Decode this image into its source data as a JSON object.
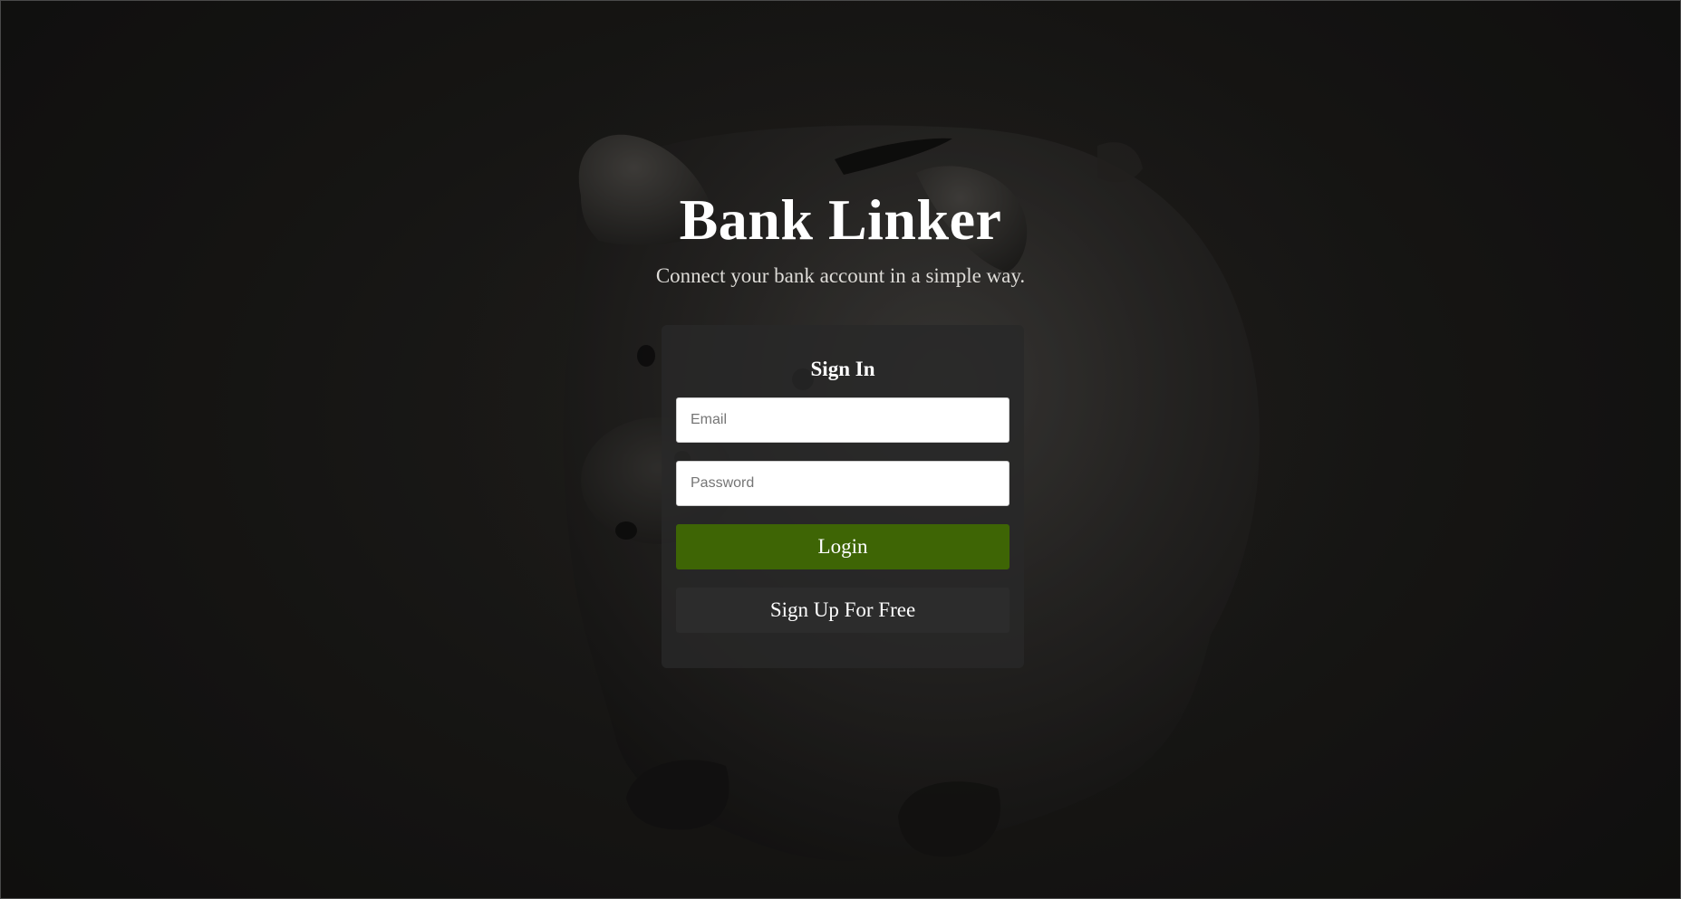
{
  "app": {
    "title": "Bank Linker",
    "tagline": "Connect your bank account in a simple way."
  },
  "signin": {
    "heading": "Sign In",
    "email_placeholder": "Email",
    "email_value": "",
    "password_placeholder": "Password",
    "password_value": "",
    "login_label": "Login",
    "signup_label": "Sign Up For Free"
  },
  "background": {
    "subject": "piggy-bank",
    "base_color": "#1a1917"
  },
  "colors": {
    "login_button": "#3e6505",
    "signup_button": "#2c2c2c",
    "card": "#282828"
  }
}
